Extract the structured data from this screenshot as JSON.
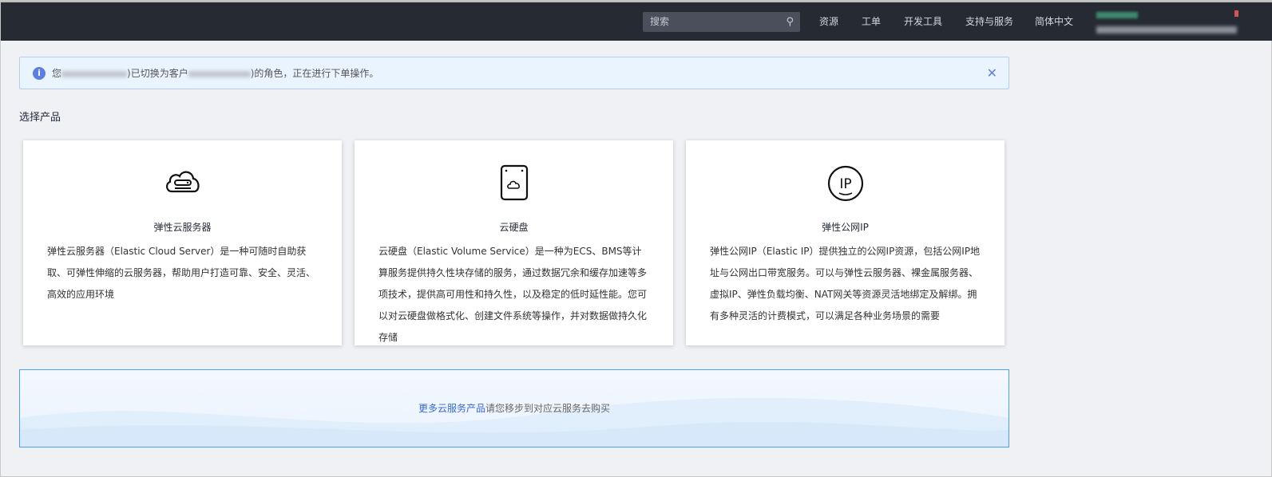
{
  "header": {
    "search_placeholder": "搜索",
    "nav": [
      "资源",
      "工单",
      "开发工具",
      "支持与服务",
      "简体中文"
    ]
  },
  "alert": {
    "prefix": "您",
    "middle": ")已切换为客户",
    "suffix": ")的角色，正在进行下单操作。"
  },
  "section_title": "选择产品",
  "products": [
    {
      "name": "弹性云服务器",
      "icon": "cloud-server-icon",
      "desc": "弹性云服务器（Elastic Cloud Server）是一种可随时自助获取、可弹性伸缩的云服务器，帮助用户打造可靠、安全、灵活、高效的应用环境"
    },
    {
      "name": "云硬盘",
      "icon": "disk-icon",
      "desc": "云硬盘（Elastic Volume Service）是一种为ECS、BMS等计算服务提供持久性块存储的服务，通过数据冗余和缓存加速等多项技术，提供高可用性和持久性，以及稳定的低时延性能。您可以对云硬盘做格式化、创建文件系统等操作，并对数据做持久化存储"
    },
    {
      "name": "弹性公网IP",
      "icon": "elastic-ip-icon",
      "desc": "弹性公网IP（Elastic IP）提供独立的公网IP资源，包括公网IP地址与公网出口带宽服务。可以与弹性云服务器、裸金属服务器、虚拟IP、弹性负载均衡、NAT网关等资源灵活地绑定及解绑。拥有多种灵活的计费模式，可以满足各种业务场景的需要"
    }
  ],
  "banner": {
    "link": "更多云服务产品",
    "text": "请您移步到对应云服务去购买"
  }
}
